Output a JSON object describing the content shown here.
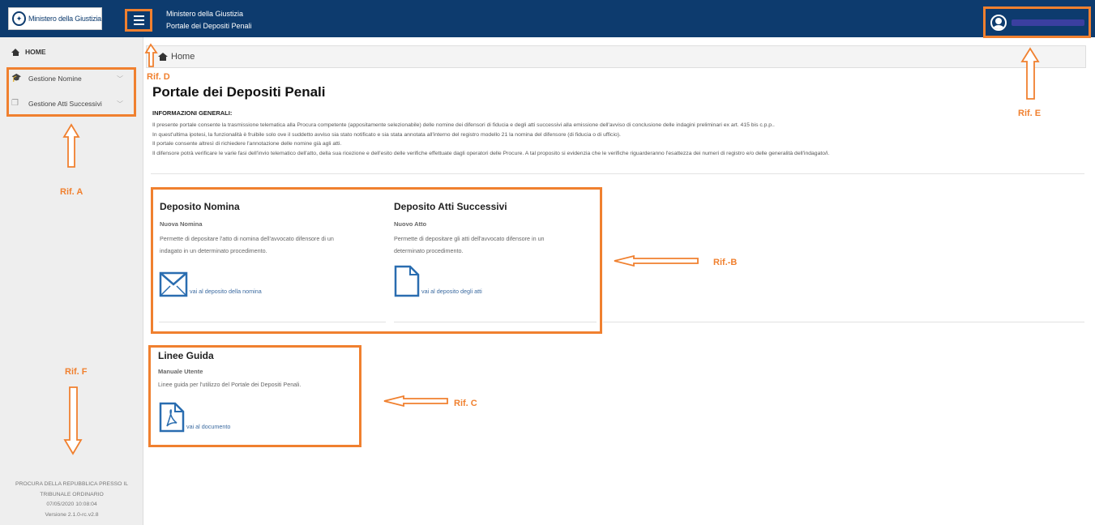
{
  "topbar": {
    "logo_text": "Ministero della Giustizia",
    "title_line1": "Ministero della Giustizia",
    "title_line2": "Portale dei Depositi Penali",
    "bar_color": "#0d3b6e"
  },
  "sidebar": {
    "home": "HOME",
    "items": [
      {
        "label": "Gestione Nomine",
        "icon": "graduation-cap-icon"
      },
      {
        "label": "Gestione Atti Successivi",
        "icon": "copy-icon"
      }
    ],
    "footer": [
      "PROCURA DELLA REPUBBLICA PRESSO IL",
      "TRIBUNALE ORDINARIO",
      "07/05/2020 10:08:04",
      "Versione 2.1.0-rc.v2.8"
    ]
  },
  "breadcrumb": {
    "label": "Home"
  },
  "main": {
    "title": "Portale dei Depositi Penali",
    "info_heading": "INFORMAZIONI GENERALI:",
    "info_lines": [
      "Il presente portale consente la trasmissione telematica alla Procura competente (appositamente selezionabile) delle nomine dei difensori di fiducia e degli atti successivi alla emissione dell'avviso di conclusione delle indagini preliminari ex art. 415 bis c.p.p..",
      "In quest'ultima ipotesi, la funzionalità è fruibile solo ove il suddetto avviso sia stato notificato e sia stata annotata all'interno del registro modello 21 la nomina del difensore (di fiducia o di ufficio).",
      "Il portale consente altresì di richiedere l'annotazione delle nomine già agli atti.",
      "Il difensore potrà verificare le varie fasi dell'invio telematico dell'atto, della sua ricezione e dell'esito delle verifiche effettuate dagli operatori delle Procure. A tal proposito si evidenzia che le verifiche riguarderanno l'esattezza dei numeri di registro e/o delle generalità dell'indagato/i."
    ],
    "cards": [
      {
        "title": "Deposito Nomina",
        "subtitle": "Nuova Nomina",
        "desc1": "Permette di depositare l'atto di nomina dell'avvocato difensore di un",
        "desc2": "indagato in un determinato procedimento.",
        "link": "vai al deposito della nomina",
        "icon": "envelope-icon"
      },
      {
        "title": "Deposito Atti Successivi",
        "subtitle": "Nuovo Atto",
        "desc1": "Permette di depositare gli atti dell'avvocato difensore in un",
        "desc2": "determinato procedimento.",
        "link": "vai al deposito degli atti",
        "icon": "document-icon"
      }
    ],
    "guide": {
      "title": "Linee Guida",
      "subtitle": "Manuale Utente",
      "desc": "Linee guida per l'utilizzo del Portale dei Depositi Penali.",
      "link": "vai al documento",
      "icon": "pdf-icon"
    }
  },
  "annotations": {
    "a": "Rif. A",
    "b": "Rif.-B",
    "c": "Rif. C",
    "d": "Rif. D",
    "e": "Rif. E",
    "f": "Rif. F",
    "color": "#f0802f"
  }
}
